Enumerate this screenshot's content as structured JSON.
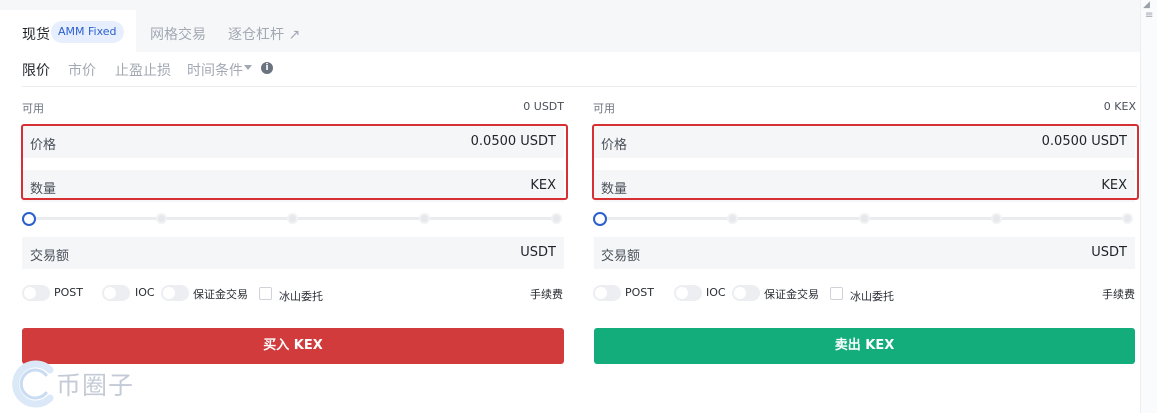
{
  "tabs": {
    "spot": "现货",
    "amm_badge": "AMM Fixed",
    "grid": "网格交易",
    "isolated_margin": "逐仓杠杆 ↗"
  },
  "order_types": {
    "limit": "限价",
    "market": "市价",
    "take_profit_stop_loss": "止盈止损",
    "time_condition": "时间条件",
    "info_icon": "i"
  },
  "buy": {
    "available_label": "可用",
    "available_value": "0 USDT",
    "price_label": "价格",
    "price_value": "0.0500 USDT",
    "amount_label": "数量",
    "amount_unit": "KEX",
    "total_label": "交易额",
    "total_unit": "USDT",
    "slider_percent": 0,
    "options": {
      "post": "POST",
      "ioc": "IOC",
      "margin": "保证金交易",
      "iceberg": "冰山委托"
    },
    "fee_label": "手续费",
    "button_label": "买入 KEX",
    "button_color": "#d13b3b"
  },
  "sell": {
    "available_label": "可用",
    "available_value": "0 KEX",
    "price_label": "价格",
    "price_value": "0.0500 USDT",
    "amount_label": "数量",
    "amount_unit": "KEX",
    "total_label": "交易额",
    "total_unit": "USDT",
    "slider_percent": 0,
    "options": {
      "post": "POST",
      "ioc": "IOC",
      "margin": "保证金交易",
      "iceberg": "冰山委托"
    },
    "fee_label": "手续费",
    "button_label": "卖出 KEX",
    "button_color": "#13ad7b"
  },
  "watermark": "币圈子",
  "colors": {
    "accent": "#2b5fce",
    "highlight_border": "#d63034"
  }
}
